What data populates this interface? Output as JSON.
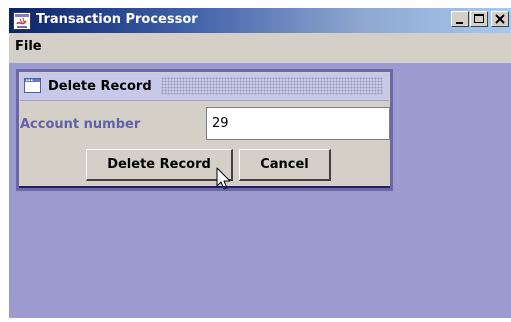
{
  "window": {
    "title": "Transaction Processor",
    "icon": "java-app-icon",
    "controls": [
      "minimize-icon",
      "maximize-icon",
      "close-icon"
    ]
  },
  "menubar": {
    "items": [
      "File"
    ]
  },
  "dialog": {
    "title": "Delete Record",
    "icon": "internal-frame-icon",
    "field_label": "Account number",
    "field_value": "29",
    "delete_label": "Delete Record",
    "cancel_label": "Cancel"
  },
  "colors": {
    "desktop": "#9c9ace",
    "dialog_border": "#6a68a8",
    "dialog_title_bg": "#c8c8e8",
    "label_text": "#6460a8",
    "titlebar_start": "#0a246a",
    "titlebar_end": "#a6caf0"
  }
}
